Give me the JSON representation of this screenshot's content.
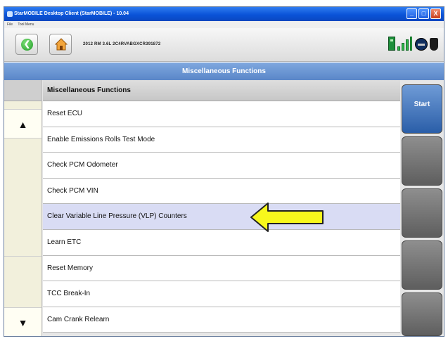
{
  "window": {
    "title": "StarMOBILE Desktop Client (StarMOBILE) - 10.04",
    "menu": [
      "File",
      "Tool Menu"
    ],
    "buttons": [
      "_",
      "□",
      "X"
    ]
  },
  "toolbar": {
    "vehicle": "2012  RM  3.6L  2C4RVABGXCR391872"
  },
  "header": {
    "title": "Miscellaneous Functions"
  },
  "table": {
    "column_header": "Miscellaneous Functions",
    "rows": [
      "Reset ECU",
      "Enable Emissions Rolls Test Mode",
      "Check PCM Odometer",
      "Check PCM VIN",
      "Clear Variable Line Pressure (VLP) Counters",
      "Learn ETC",
      "Reset Memory",
      "TCC Break-In",
      "Cam Crank Relearn"
    ],
    "selected_index": 4
  },
  "scroll": {
    "up": "▲",
    "down": "▼"
  },
  "side": {
    "start_label": "Start"
  },
  "colors": {
    "header": "#5a86c8",
    "selected_row": "#d9dcf4",
    "arrow": "#f5f51a"
  }
}
